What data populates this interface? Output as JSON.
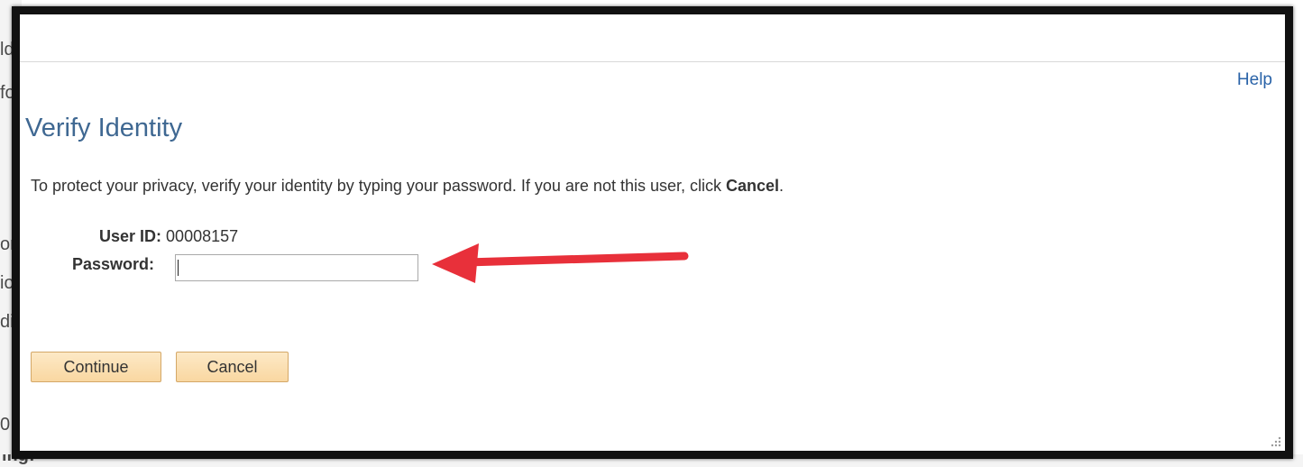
{
  "background": {
    "fragments": [
      "ld",
      "fo",
      "or",
      "io",
      "di",
      "0",
      "ing:"
    ]
  },
  "dialog": {
    "help_label": "Help",
    "title": "Verify Identity",
    "instruction_prefix": "To protect your privacy, verify your identity by typing your password. If you are not this user, click ",
    "instruction_bold": "Cancel",
    "instruction_suffix": ".",
    "user_id_label": "User ID:",
    "user_id_value": "00008157",
    "password_label": "Password:",
    "password_value": "",
    "continue_label": "Continue",
    "cancel_label": "Cancel"
  },
  "colors": {
    "title": "#3f6892",
    "link": "#2a63a8",
    "button_fill": "#f9d7a1",
    "annotation_arrow": "#e8303a"
  },
  "annotation": {
    "icon": "red-arrow-icon"
  }
}
